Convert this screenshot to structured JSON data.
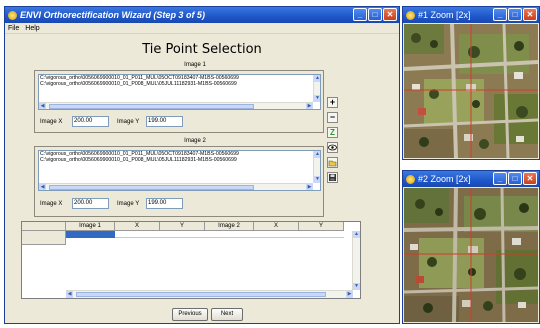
{
  "wizard": {
    "title": "ENVI Orthorectification Wizard (Step 3 of 5)",
    "menu": [
      "File",
      "Help"
    ],
    "heading": "Tie Point Selection",
    "image1": {
      "label": "Image 1",
      "paths": [
        "C:\\vigorous_ortho\\0056069900010_01_P011_MUL\\05OCT09183407-M1BS-00560699",
        "C:\\vigorous_ortho\\0056069900010_01_P008_MUL\\05JUL11182931-M1BS-00560699"
      ],
      "x_label": "Image X",
      "x_value": "200.00",
      "y_label": "Image Y",
      "y_value": "199.00"
    },
    "image2": {
      "label": "Image 2",
      "paths": [
        "C:\\vigorous_ortho\\0056069900010_01_P011_MUL\\05OCT09183407-M1BS-00560699",
        "C:\\vigorous_ortho\\0056069900010_01_P008_MUL\\05JUL11182931-M1BS-00560699"
      ],
      "x_label": "Image X",
      "x_value": "200.00",
      "y_label": "Image Y",
      "y_value": "199.00"
    },
    "tools": {
      "add_symbol": "+",
      "remove_symbol": "−"
    },
    "table": {
      "columns": [
        "Image 1",
        "X",
        "Y",
        "Image 2",
        "X",
        "Y"
      ]
    },
    "buttons": {
      "previous": "Previous",
      "next": "Next"
    }
  },
  "zoom1": {
    "title": "#1 Zoom [2x]"
  },
  "zoom2": {
    "title": "#2 Zoom [2x]"
  },
  "colors": {
    "titlebar": "#2a5fd0",
    "dialog_bg": "#ece9d8",
    "selection": "#316ac5",
    "tie_line": "#d23c2a"
  }
}
